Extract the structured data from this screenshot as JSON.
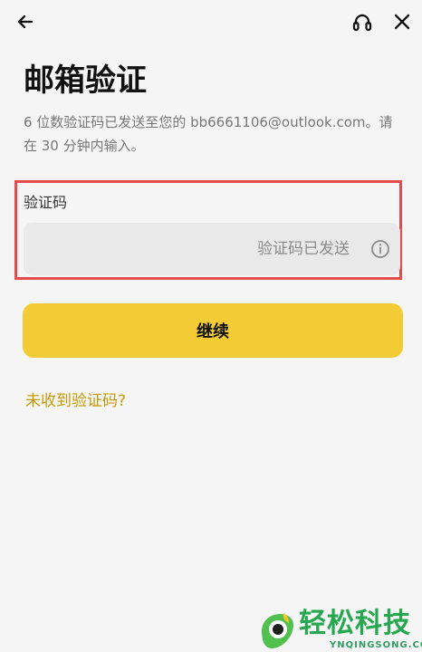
{
  "header": {
    "back_icon": "back-arrow-icon",
    "support_icon": "headset-icon",
    "close_icon": "close-icon"
  },
  "main": {
    "title": "邮箱验证",
    "description": "6 位数验证码已发送至您的 bb6661106@outlook.com。请在 30 分钟内输入。",
    "field_label": "验证码",
    "code_input": {
      "value": "",
      "placeholder": "验证码已发送"
    },
    "info_icon": "info-icon",
    "continue_label": "继续",
    "resend_link": "未收到验证码?"
  },
  "watermark": {
    "name": "轻松科技",
    "domain": "YNQINGSONG.COM"
  },
  "colors": {
    "background": "#f5f5f5",
    "accent_button": "#f3cc35",
    "link": "#c49a06",
    "highlight_border": "#e34b4f",
    "input_background": "#e9e9e9"
  }
}
